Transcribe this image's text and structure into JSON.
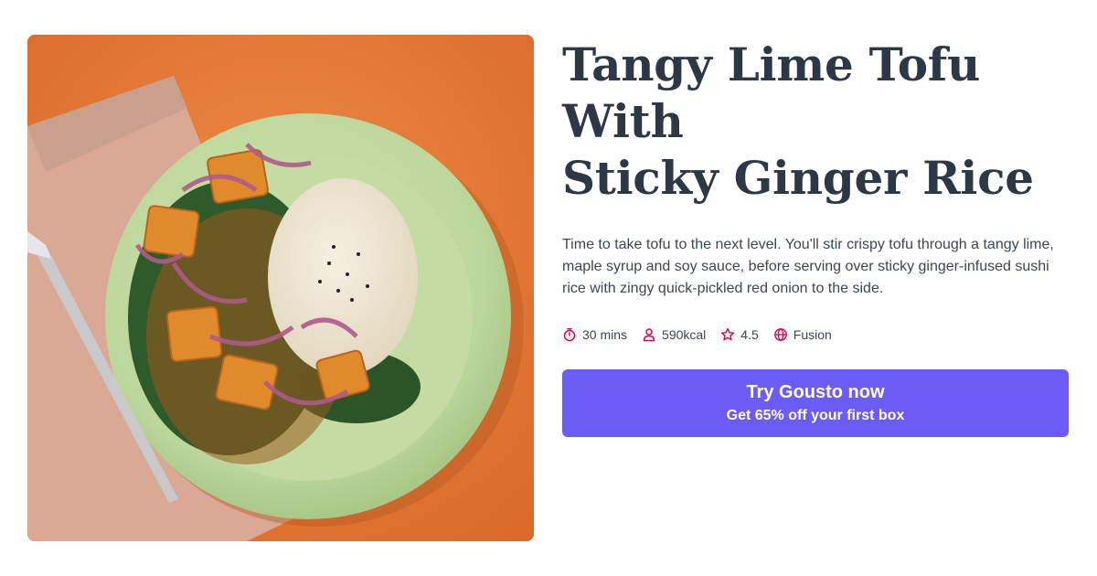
{
  "recipe": {
    "title_line1": "Tangy Lime Tofu With",
    "title_line2": "Sticky Ginger Rice",
    "description": "Time to take tofu to the next level. You'll stir crispy tofu through a tangy lime, maple syrup and soy sauce, before serving over sticky ginger-infused sushi rice with zingy quick-pickled red onion to the side.",
    "image_icon": "recipe-photo"
  },
  "meta": {
    "time": "30 mins",
    "calories": "590kcal",
    "rating": "4.5",
    "cuisine": "Fusion",
    "icons": [
      "stopwatch-icon",
      "person-icon",
      "star-icon",
      "globe-icon"
    ],
    "icon_color": "#e0004d"
  },
  "cta": {
    "label": "Try Gousto now",
    "sublabel": "Get 65% off your first box",
    "color": "#6b5cf6"
  }
}
